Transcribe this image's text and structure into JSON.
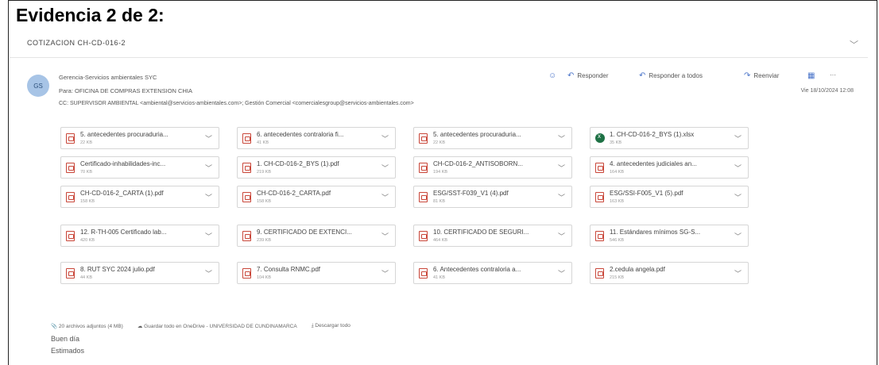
{
  "heading": "Evidencia 2 de 2:",
  "email": {
    "subject": "COTIZACION CH-CD-016-2",
    "avatar_initials": "GS",
    "sender": "Gerencia-Servicios ambientales SYC",
    "to": "Para: OFICINA DE COMPRAS EXTENSION CHIA",
    "cc": "CC: SUPERVISOR AMBIENTAL <ambiental@servicios-ambientales.com>; Gestión Comercial <comercialesgroup@servicios-ambientales.com>",
    "date": "Vie 18/10/2024 12:08",
    "actions": {
      "emoji": "☺",
      "reply": "Responder",
      "reply_all": "Responder a todos",
      "forward": "Reenviar",
      "more": "···"
    },
    "attachments": [
      {
        "name": "5. antecedentes procuraduria...",
        "size": "22 KB",
        "type": "pdf"
      },
      {
        "name": "6. antecedentes contraloria fi...",
        "size": "41 KB",
        "type": "pdf"
      },
      {
        "name": "5. antecedentes procuraduria...",
        "size": "22 KB",
        "type": "pdf"
      },
      {
        "name": "1. CH-CD-016-2_BYS (1).xlsx",
        "size": "35 KB",
        "type": "xlsx"
      },
      {
        "name": "Certificado-inhabilidades-inc...",
        "size": "70 KB",
        "type": "pdf"
      },
      {
        "name": "1. CH-CD-016-2_BYS (1).pdf",
        "size": "219 KB",
        "type": "pdf"
      },
      {
        "name": "CH-CD-016-2_ANTISOBORN...",
        "size": "194 KB",
        "type": "pdf"
      },
      {
        "name": "4. antecedentes judiciales an...",
        "size": "164 KB",
        "type": "pdf"
      },
      {
        "name": "CH-CD-016-2_CARTA (1).pdf",
        "size": "158 KB",
        "type": "pdf"
      },
      {
        "name": "CH-CD-016-2_CARTA.pdf",
        "size": "158 KB",
        "type": "pdf"
      },
      {
        "name": "ESG/SST-F039_V1 (4).pdf",
        "size": "81 KB",
        "type": "pdf"
      },
      {
        "name": "ESG/SSI-F005_V1 (5).pdf",
        "size": "163 KB",
        "type": "pdf"
      },
      {
        "name": "12. R-TH-005 Certificado lab...",
        "size": "420 KB",
        "type": "pdf"
      },
      {
        "name": "9. CERTIFICADO DE EXTENCI...",
        "size": "239 KB",
        "type": "pdf"
      },
      {
        "name": "10. CERTIFICADO DE SEGURI...",
        "size": "464 KB",
        "type": "pdf"
      },
      {
        "name": "11. Estándares mínimos SG-S...",
        "size": "546 KB",
        "type": "pdf"
      },
      {
        "name": "8. RUT SYC 2024 julio.pdf",
        "size": "44 KB",
        "type": "pdf"
      },
      {
        "name": "7. Consulta RNMC.pdf",
        "size": "104 KB",
        "type": "pdf"
      },
      {
        "name": "6. Antecedentes contraloria a...",
        "size": "41 KB",
        "type": "pdf"
      },
      {
        "name": "2.cedula angela.pdf",
        "size": "215 KB",
        "type": "pdf"
      }
    ],
    "footer": {
      "count": "20 archivos adjuntos (4 MB)",
      "save": "Guardar todo en OneDrive - UNIVERSIDAD DE CUNDINAMARCA",
      "download": "Descargar todo"
    },
    "body": [
      "Buen día",
      "Estimados"
    ]
  }
}
